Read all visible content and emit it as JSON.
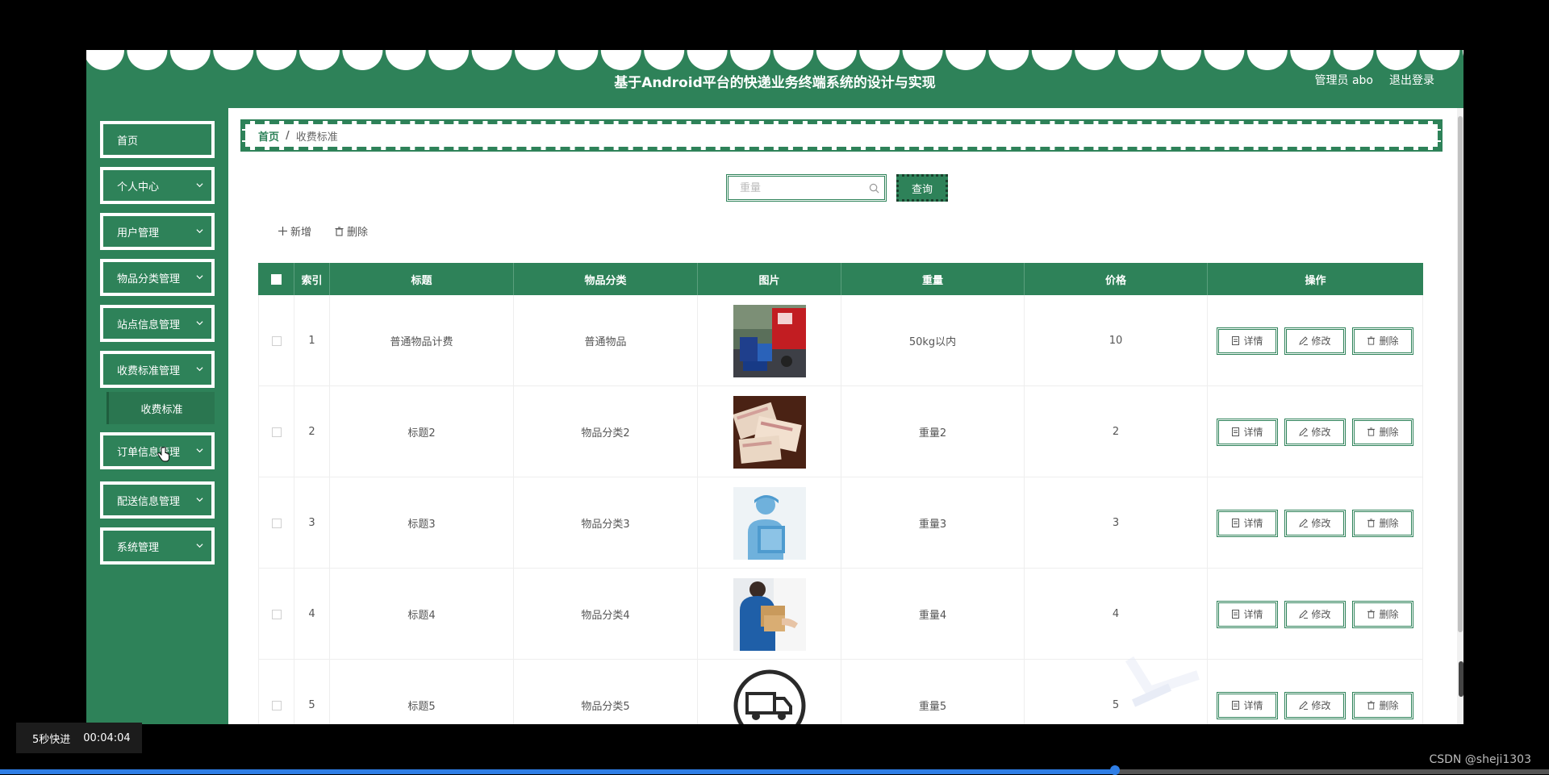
{
  "app": {
    "title": "基于Android平台的快递业务终端系统的设计与实现",
    "user_label": "管理员 abo",
    "logout_label": "退出登录"
  },
  "sidebar": {
    "items": [
      {
        "label": "首页"
      },
      {
        "label": "个人中心"
      },
      {
        "label": "用户管理"
      },
      {
        "label": "物品分类管理"
      },
      {
        "label": "站点信息管理"
      },
      {
        "label": "收费标准管理"
      },
      {
        "label": "订单信息管理"
      },
      {
        "label": "配送信息管理"
      },
      {
        "label": "系统管理"
      }
    ],
    "active_submenu": "收费标准"
  },
  "breadcrumb": {
    "home": "首页",
    "separator": "/",
    "current": "收费标准"
  },
  "search": {
    "placeholder": "重量",
    "button": "查询"
  },
  "toolbar": {
    "add_label": "新增",
    "delete_label": "删除"
  },
  "table": {
    "headers": [
      "索引",
      "标题",
      "物品分类",
      "图片",
      "重量",
      "价格",
      "操作"
    ],
    "rows": [
      {
        "index": "1",
        "title": "普通物品计费",
        "category": "普通物品",
        "image": "delivery-van-photo",
        "weight": "50kg以内",
        "price": "10"
      },
      {
        "index": "2",
        "title": "标题2",
        "category": "物品分类2",
        "image": "parcels-photo",
        "weight": "重量2",
        "price": "2"
      },
      {
        "index": "3",
        "title": "标题3",
        "category": "物品分类3",
        "image": "courier-illustration",
        "weight": "重量3",
        "price": "3"
      },
      {
        "index": "4",
        "title": "标题4",
        "category": "物品分类4",
        "image": "handover-photo",
        "weight": "重量4",
        "price": "4"
      },
      {
        "index": "5",
        "title": "标题5",
        "category": "物品分类5",
        "image": "truck-icon",
        "weight": "重量5",
        "price": "5"
      }
    ],
    "ops": {
      "detail": "详情",
      "edit": "修改",
      "delete": "删除"
    }
  },
  "player": {
    "ff_label": "5秒快进",
    "time": "00:04:04",
    "progress": 0.72,
    "watermark": "CSDN @sheji1303"
  },
  "colors": {
    "primary": "#2e8259",
    "progress": "#2f7ee6"
  }
}
